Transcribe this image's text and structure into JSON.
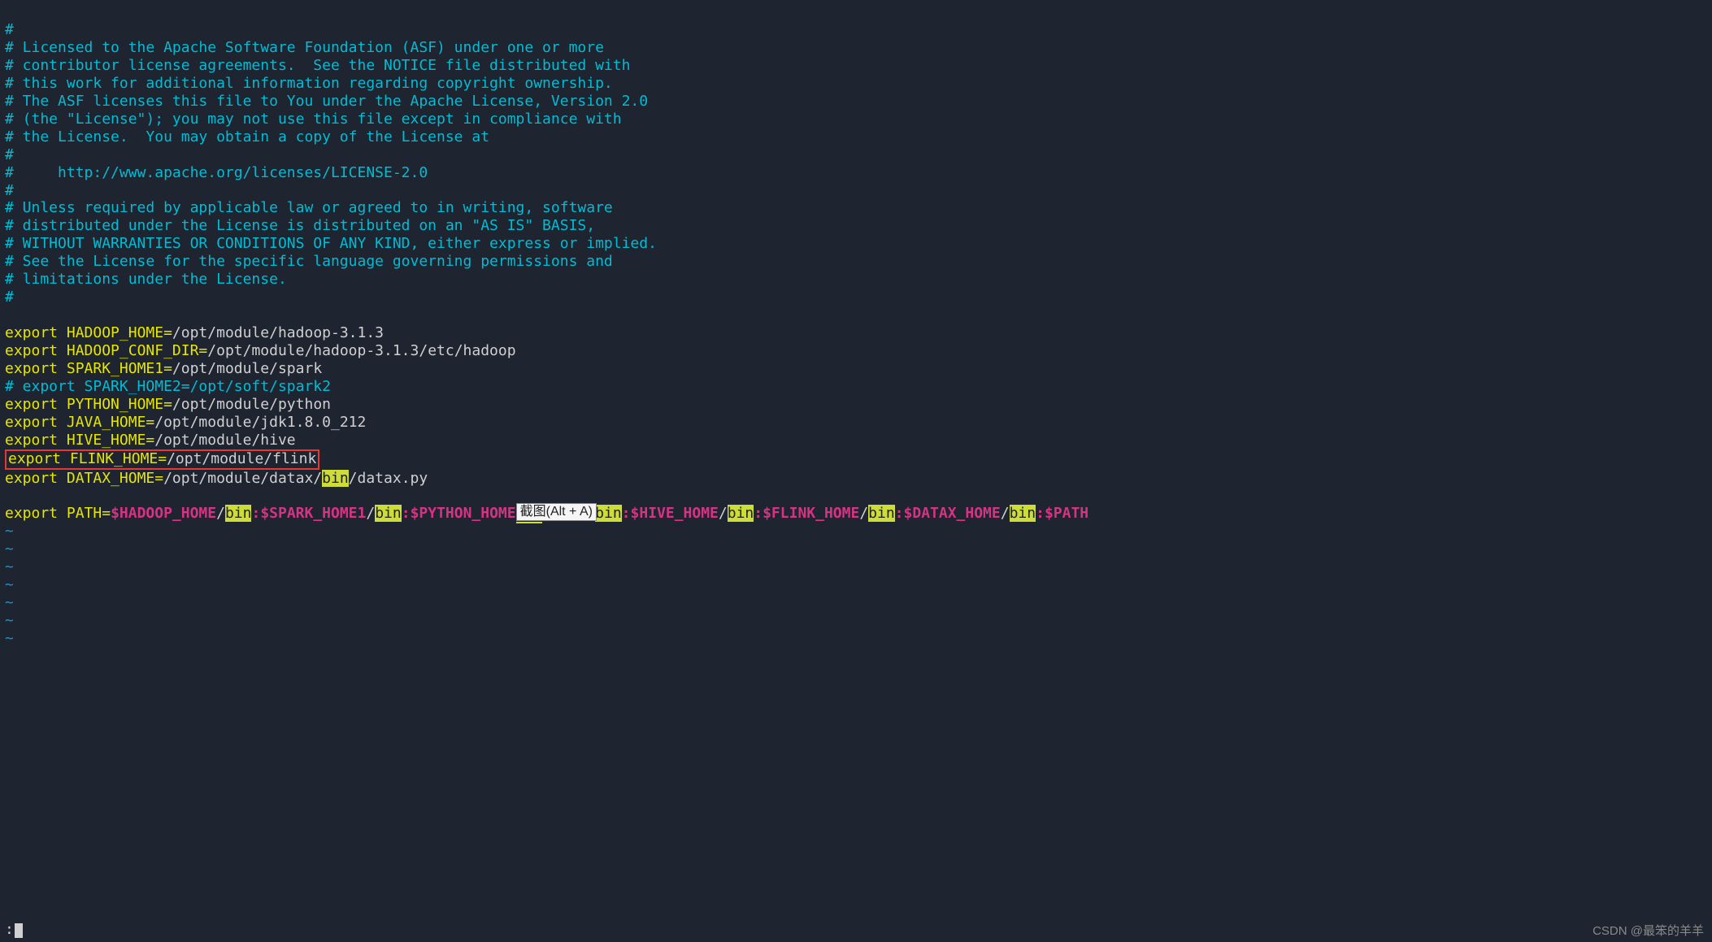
{
  "license_comments": [
    "#",
    "# Licensed to the Apache Software Foundation (ASF) under one or more",
    "# contributor license agreements.  See the NOTICE file distributed with",
    "# this work for additional information regarding copyright ownership.",
    "# The ASF licenses this file to You under the Apache License, Version 2.0",
    "# (the \"License\"); you may not use this file except in compliance with",
    "# the License.  You may obtain a copy of the License at",
    "#",
    "#     http://www.apache.org/licenses/LICENSE-2.0",
    "#",
    "# Unless required by applicable law or agreed to in writing, software",
    "# distributed under the License is distributed on an \"AS IS\" BASIS,",
    "# WITHOUT WARRANTIES OR CONDITIONS OF ANY KIND, either express or implied.",
    "# See the License for the specific language governing permissions and",
    "# limitations under the License.",
    "#"
  ],
  "exports": {
    "hadoop_home": {
      "kw": "export",
      "lhs": " HADOOP_HOME=",
      "rhs": "/opt/module/hadoop-3.1.3"
    },
    "hadoop_conf": {
      "kw": "export",
      "lhs": " HADOOP_CONF_DIR=",
      "rhs": "/opt/module/hadoop-3.1.3/etc/hadoop"
    },
    "spark_home1": {
      "kw": "export",
      "lhs": " SPARK_HOME1=",
      "rhs": "/opt/module/spark"
    },
    "spark2_comment": "# export SPARK_HOME2=/opt/soft/spark2",
    "python_home": {
      "kw": "export",
      "lhs": " PYTHON_HOME=",
      "rhs": "/opt/module/python"
    },
    "java_home": {
      "kw": "export",
      "lhs": " JAVA_HOME=",
      "rhs": "/opt/module/jdk1.8.0_212"
    },
    "hive_home": {
      "kw": "export",
      "lhs": " HIVE_HOME=",
      "rhs": "/opt/module/hive"
    },
    "flink_home": {
      "kw": "export",
      "lhs": " FLINK_HOME=",
      "rhs": "/opt/module/flink"
    },
    "datax_home": {
      "kw": "export",
      "lhs": " DATAX_HOME=",
      "pre": "/opt/module/datax/",
      "bin": "bin",
      "post": "/datax.py"
    }
  },
  "path_line": {
    "kw": "export",
    "lhs": " PATH=",
    "seg1_var": "$HADOOP_HOME",
    "seg_slash": "/",
    "seg_bin": "bin",
    "seg_colon": ":",
    "seg2_var": "$SPARK_HOME1",
    "seg3_var": "$PYTHON_HOME",
    "tooltip": "截图(Alt + A)",
    "seg4_var_tail": "_HOME",
    "seg5_var": "$HIVE_HOME",
    "seg6_var": "$FLINK_HOME",
    "seg7_var": "$DATAX_HOME",
    "seg_end_var": "$PATH"
  },
  "tildes": [
    "~",
    "~",
    "~",
    "~",
    "~",
    "~",
    "~"
  ],
  "cmdline": ":",
  "watermark": "CSDN @最笨的羊羊"
}
